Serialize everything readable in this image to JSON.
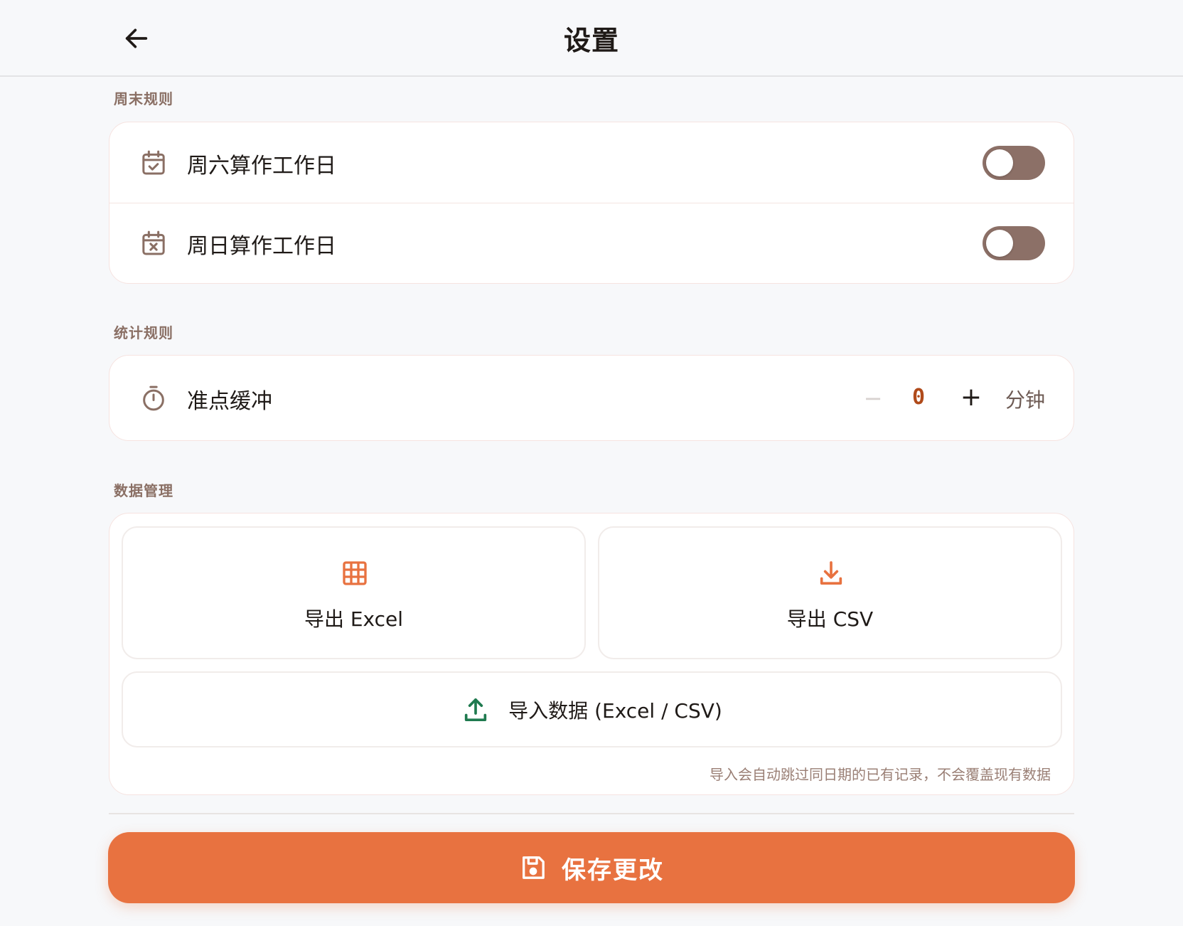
{
  "header": {
    "title": "设置"
  },
  "sections": {
    "weekend": {
      "label": "周末规则",
      "rows": [
        {
          "label": "周六算作工作日",
          "icon": "calendar-check-icon",
          "enabled": false
        },
        {
          "label": "周日算作工作日",
          "icon": "calendar-x-icon",
          "enabled": false
        }
      ]
    },
    "stats": {
      "label": "统计规则",
      "buffer": {
        "label": "准点缓冲",
        "icon": "timer-icon",
        "minus": "−",
        "value": "0",
        "plus": "+",
        "unit": "分钟"
      }
    },
    "data": {
      "label": "数据管理",
      "export_excel": {
        "label": "导出 Excel",
        "icon": "table-grid-icon"
      },
      "export_csv": {
        "label": "导出 CSV",
        "icon": "download-icon"
      },
      "import": {
        "label": "导入数据 (Excel / CSV)",
        "icon": "upload-icon"
      },
      "note": "导入会自动跳过同日期的已有记录，不会覆盖现有数据"
    }
  },
  "save": {
    "label": "保存更改",
    "icon": "save-icon"
  },
  "colors": {
    "accent": "#e87240",
    "toggle_off": "#8c7067",
    "section_label": "#8a6f64",
    "import_icon": "#1f7a4f",
    "stepper_value": "#b04a1a"
  }
}
